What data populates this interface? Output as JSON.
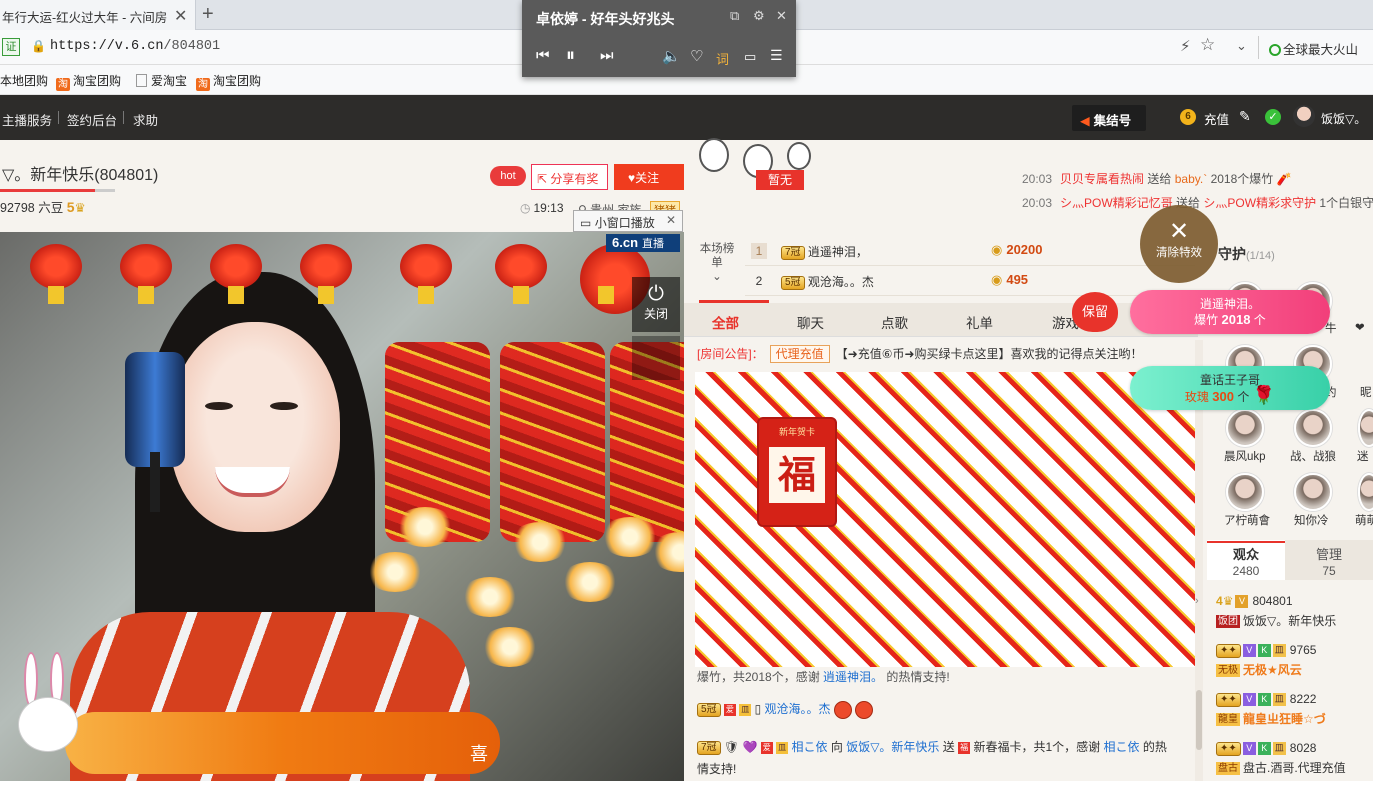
{
  "browser": {
    "tab_title": "年行大运-红火过大年 - 六间房",
    "url_host": "https://v.6.cn",
    "url_path": "/804801",
    "cert_label": "证",
    "search_placeholder": "全球最大火山",
    "bookmarks": [
      {
        "label": "本地团购"
      },
      {
        "label": "淘宝团购"
      },
      {
        "label": "爱淘宝"
      },
      {
        "label": "淘宝团购"
      }
    ]
  },
  "music": {
    "title": "卓依婷 - 好年头好兆头",
    "lyric_btn": "词"
  },
  "site": {
    "nav": [
      "主播服务",
      "签约后台",
      "求助"
    ],
    "jijie": "集结号",
    "recharge": "充值",
    "username": "饭饭▽。"
  },
  "room": {
    "title": "▽。新年快乐(804801)",
    "stats_prefix": "92798 六豆",
    "level": "5",
    "hot": "hot",
    "share": "分享有奖",
    "follow": "关注",
    "time": "19:13",
    "location": "贵州",
    "family": "家族",
    "family_tag": "猪猪",
    "small_window": "小窗口播放",
    "video_logo": "6.cn",
    "video_live": "直播",
    "close_label": "关闭",
    "cloud_char": "喜"
  },
  "gift_feed": [
    {
      "time": "20:03",
      "from": "贝贝专属看热闹",
      "verb": "送给",
      "to": "baby.`",
      "count": "2018个爆竹"
    },
    {
      "time": "20:03",
      "from": "シ灬POW精彩记忆哥",
      "verb": "送给",
      "to": "シ灬POW精彩求守护",
      "count": "1个白银守"
    }
  ],
  "zanwu": "暂无",
  "ranking": {
    "label": "本场榜单",
    "rows": [
      {
        "rank": "1",
        "badge": "7冠",
        "name": "逍遥神泪，",
        "coins": "20200"
      },
      {
        "rank": "2",
        "badge": "5冠",
        "name": "观沧海。。杰",
        "coins": "495"
      }
    ]
  },
  "tabs": [
    "全部",
    "聊天",
    "点歌",
    "礼单",
    "游戏"
  ],
  "baoliu": "保留",
  "notice": {
    "label": "[房间公告]：",
    "tag": "代理充值",
    "text": "【➜充值⑥币➜购买绿卡点这里】喜欢我的记得点关注哟！"
  },
  "fu_card": {
    "top": "新年贺卡",
    "char": "福"
  },
  "chat": {
    "msg1_pre": "爆竹，共2018个，感谢",
    "msg1_user": "逍遥神泪。",
    "msg1_post": "的热情支持!",
    "msg2_badge": "5冠",
    "msg2_user": "观沧海。。杰",
    "msg3_badge": "7冠",
    "msg3_user": "相こ依",
    "msg3_verb": "向",
    "msg3_to": "饭饭▽。新年快乐",
    "msg3_send": "送",
    "msg3_card": "新春福卡，共1个，感谢",
    "msg3_thanks_user": "相こ依",
    "msg3_post": "的热情支持!"
  },
  "clear_fx": "清除特效",
  "guard": {
    "title": "守护",
    "count": "(1/14)"
  },
  "gift_pills": [
    {
      "name": "逍遥神泪。",
      "gift": "爆竹",
      "num": "2018",
      "unit": "个"
    },
    {
      "name": "童话王子哥",
      "gift": "玫瑰",
      "num": "300",
      "unit": "个"
    }
  ],
  "guards": [
    {
      "name": "牛"
    },
    {
      "name": "❤"
    },
    {
      "name": "约"
    },
    {
      "name": "昵"
    },
    {
      "name": "晨风ukp"
    },
    {
      "name": "战、战狼"
    },
    {
      "name": "迷"
    },
    {
      "name": "ア柠萌會"
    },
    {
      "name": "知你冷"
    },
    {
      "name": "萌萌"
    }
  ],
  "audience": {
    "tab": "观众",
    "count": "2480",
    "mgr_tab": "管理",
    "mgr_count": "75",
    "list": [
      {
        "level": "4",
        "id": "804801",
        "lv": "饭团",
        "name": "饭饭▽。新年快乐"
      },
      {
        "id": "9765",
        "lv": "无极",
        "name": "无极★风云"
      },
      {
        "id": "8222",
        "lv": "龍皇",
        "name": "龍皇ㄓ狂睡☆づ"
      },
      {
        "id": "8028",
        "lv": "盘古",
        "name": "盘古.酒哥.代理充值"
      }
    ]
  },
  "colors": {
    "accent": "#e8332b",
    "orange": "#f07b12",
    "header_bg": "#2d2c2a"
  }
}
